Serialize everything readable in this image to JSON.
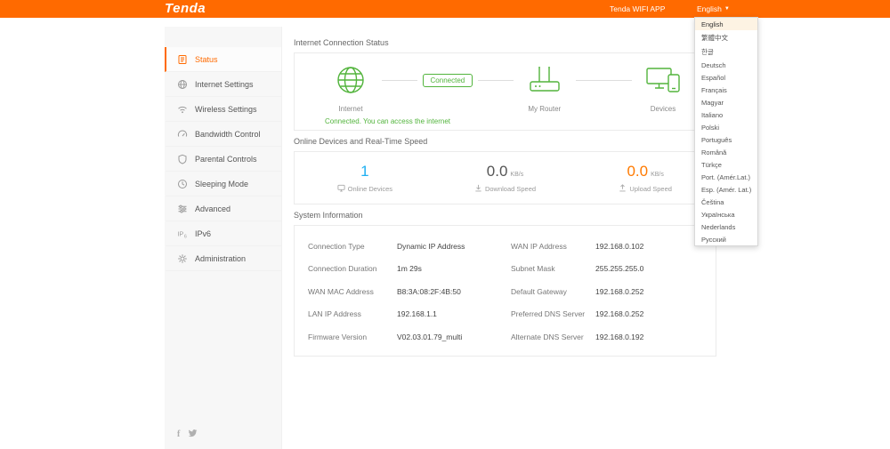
{
  "header": {
    "logo": "Tenda",
    "wifi_app": "Tenda WIFI APP",
    "language_label": "English"
  },
  "language_menu": {
    "items": [
      "English",
      "繁體中文",
      "한글",
      "Deutsch",
      "Español",
      "Français",
      "Magyar",
      "Italiano",
      "Polski",
      "Português",
      "Română",
      "Türkçe",
      "Port. (Amér.Lat.)",
      "Esp. (Amér. Lat.)",
      "Čeština",
      "Українська",
      "Nederlands",
      "Русский"
    ],
    "selected": "English"
  },
  "sidebar": {
    "items": [
      {
        "label": "Status",
        "icon": "status-icon",
        "active": true
      },
      {
        "label": "Internet Settings",
        "icon": "internet-settings-icon",
        "active": false
      },
      {
        "label": "Wireless Settings",
        "icon": "wireless-settings-icon",
        "active": false
      },
      {
        "label": "Bandwidth Control",
        "icon": "bandwidth-control-icon",
        "active": false
      },
      {
        "label": "Parental Controls",
        "icon": "parental-controls-icon",
        "active": false
      },
      {
        "label": "Sleeping Mode",
        "icon": "sleeping-mode-icon",
        "active": false
      },
      {
        "label": "Advanced",
        "icon": "advanced-icon",
        "active": false
      },
      {
        "label": "IPv6",
        "icon": "ipv6-icon",
        "active": false
      },
      {
        "label": "Administration",
        "icon": "administration-icon",
        "active": false
      }
    ]
  },
  "connection": {
    "title": "Internet Connection Status",
    "badge": "Connected",
    "internet_label": "Internet",
    "router_label": "My Router",
    "devices_label": "Devices",
    "message": "Connected. You can access the internet"
  },
  "speed": {
    "title": "Online Devices and Real-Time Speed",
    "online": {
      "value": "1",
      "label": "Online Devices"
    },
    "download": {
      "value": "0.0",
      "unit": "KB/s",
      "label": "Download Speed"
    },
    "upload": {
      "value": "0.0",
      "unit": "KB/s",
      "label": "Upload Speed"
    }
  },
  "system": {
    "title": "System Information",
    "rows": [
      {
        "l_label": "Connection Type",
        "l_value": "Dynamic IP Address",
        "r_label": "WAN IP Address",
        "r_value": "192.168.0.102"
      },
      {
        "l_label": "Connection Duration",
        "l_value": "1m 29s",
        "r_label": "Subnet Mask",
        "r_value": "255.255.255.0"
      },
      {
        "l_label": "WAN MAC Address",
        "l_value": "B8:3A:08:2F:4B:50",
        "r_label": "Default Gateway",
        "r_value": "192.168.0.252"
      },
      {
        "l_label": "LAN IP Address",
        "l_value": "192.168.1.1",
        "r_label": "Preferred DNS Server",
        "r_value": "192.168.0.252"
      },
      {
        "l_label": "Firmware Version",
        "l_value": "V02.03.01.79_multi",
        "r_label": "Alternate DNS Server",
        "r_value": "192.168.0.192"
      }
    ]
  },
  "colors": {
    "accent": "#ff6a00",
    "green": "#52b43c",
    "blue": "#1fb0f2",
    "upload_orange": "#ff7a00"
  }
}
